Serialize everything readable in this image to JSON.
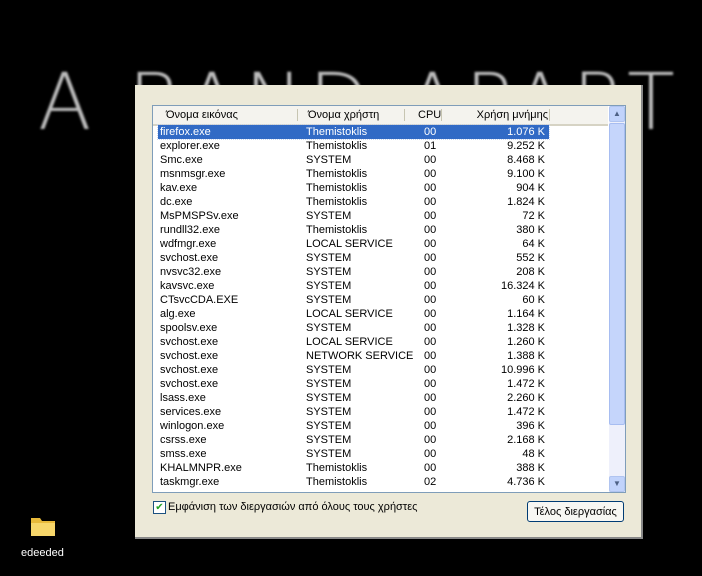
{
  "wallpaper": {
    "text": "A BAND APART"
  },
  "table": {
    "columns": [
      "Όνομα εικόνας",
      "Όνομα χρήστη",
      "CPU",
      "Χρήση μνήμης"
    ],
    "rows": [
      [
        "firefox.exe",
        "Themistoklis",
        "00",
        "1.076 K"
      ],
      [
        "explorer.exe",
        "Themistoklis",
        "01",
        "9.252 K"
      ],
      [
        "Smc.exe",
        "SYSTEM",
        "00",
        "8.468 K"
      ],
      [
        "msnmsgr.exe",
        "Themistoklis",
        "00",
        "9.100 K"
      ],
      [
        "kav.exe",
        "Themistoklis",
        "00",
        "904 K"
      ],
      [
        "dc.exe",
        "Themistoklis",
        "00",
        "1.824 K"
      ],
      [
        "MsPMSPSv.exe",
        "SYSTEM",
        "00",
        "72 K"
      ],
      [
        "rundll32.exe",
        "Themistoklis",
        "00",
        "380 K"
      ],
      [
        "wdfmgr.exe",
        "LOCAL SERVICE",
        "00",
        "64 K"
      ],
      [
        "svchost.exe",
        "SYSTEM",
        "00",
        "552 K"
      ],
      [
        "nvsvc32.exe",
        "SYSTEM",
        "00",
        "208 K"
      ],
      [
        "kavsvc.exe",
        "SYSTEM",
        "00",
        "16.324 K"
      ],
      [
        "CTsvcCDA.EXE",
        "SYSTEM",
        "00",
        "60 K"
      ],
      [
        "alg.exe",
        "LOCAL SERVICE",
        "00",
        "1.164 K"
      ],
      [
        "spoolsv.exe",
        "SYSTEM",
        "00",
        "1.328 K"
      ],
      [
        "svchost.exe",
        "LOCAL SERVICE",
        "00",
        "1.260 K"
      ],
      [
        "svchost.exe",
        "NETWORK SERVICE",
        "00",
        "1.388 K"
      ],
      [
        "svchost.exe",
        "SYSTEM",
        "00",
        "10.996 K"
      ],
      [
        "svchost.exe",
        "SYSTEM",
        "00",
        "1.472 K"
      ],
      [
        "lsass.exe",
        "SYSTEM",
        "00",
        "2.260 K"
      ],
      [
        "services.exe",
        "SYSTEM",
        "00",
        "1.472 K"
      ],
      [
        "winlogon.exe",
        "SYSTEM",
        "00",
        "396 K"
      ],
      [
        "csrss.exe",
        "SYSTEM",
        "00",
        "2.168 K"
      ],
      [
        "smss.exe",
        "SYSTEM",
        "00",
        "48 K"
      ],
      [
        "KHALMNPR.exe",
        "Themistoklis",
        "00",
        "388 K"
      ],
      [
        "taskmgr.exe",
        "Themistoklis",
        "02",
        "4.736 K"
      ]
    ],
    "selected_index": 0
  },
  "show_all_users": {
    "label": "Εμφάνιση των διεργασιών από όλους τους χρήστες",
    "checked": true
  },
  "end_process_label": "Τέλος διεργασίας",
  "desktop_icon": {
    "label": "edeeded",
    "icon": "folder-icon"
  }
}
